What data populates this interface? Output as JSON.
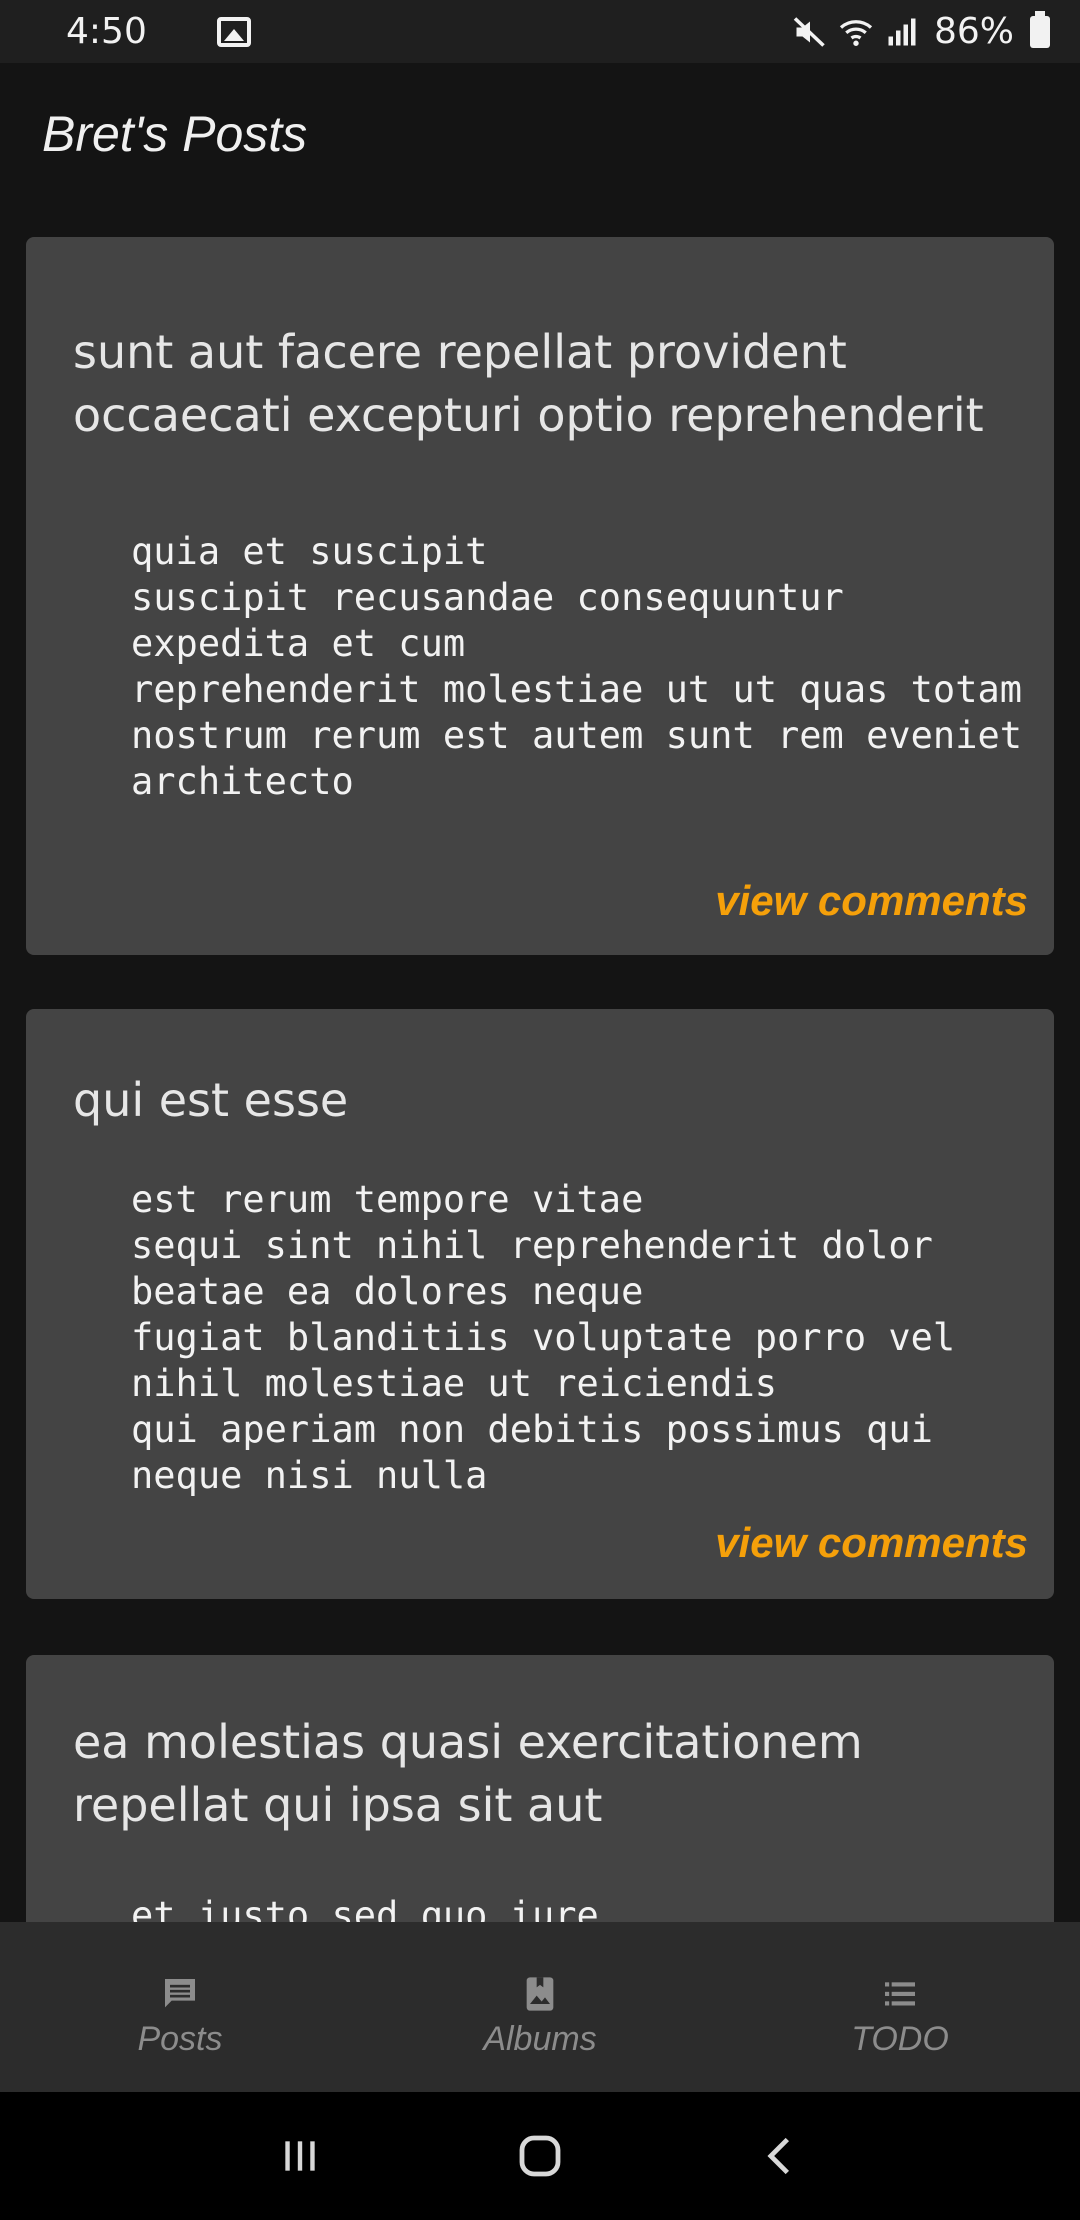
{
  "status_bar": {
    "time": "4:50",
    "battery": "86%",
    "icons": [
      "image-icon",
      "mute-icon",
      "wifi-icon",
      "signal-icon",
      "battery-icon"
    ]
  },
  "header": {
    "title": "Bret's Posts"
  },
  "posts": [
    {
      "title": "sunt aut facere repellat provident occaecati excepturi optio reprehenderit",
      "body": "quia et suscipit\nsuscipit recusandae consequuntur expedita et cum\nreprehenderit molestiae ut ut quas totam\nnostrum rerum est autem sunt rem eveniet architecto",
      "link": "view comments"
    },
    {
      "title": "qui est esse",
      "body": "est rerum tempore vitae\nsequi sint nihil reprehenderit dolor beatae ea dolores neque\nfugiat blanditiis voluptate porro vel nihil molestiae ut reiciendis\nqui aperiam non debitis possimus qui neque nisi nulla",
      "link": "view comments"
    },
    {
      "title": "ea molestias quasi exercitationem repellat qui ipsa sit aut",
      "body": "et iusto sed quo iure",
      "link": ""
    }
  ],
  "tabs": [
    {
      "label": "Posts",
      "icon": "comment-icon"
    },
    {
      "label": "Albums",
      "icon": "photo-album-icon"
    },
    {
      "label": "TODO",
      "icon": "list-icon"
    }
  ],
  "colors": {
    "accent": "#f5a00a",
    "card": "#444444",
    "background": "#141414",
    "tabbar": "#2c2c2c"
  }
}
